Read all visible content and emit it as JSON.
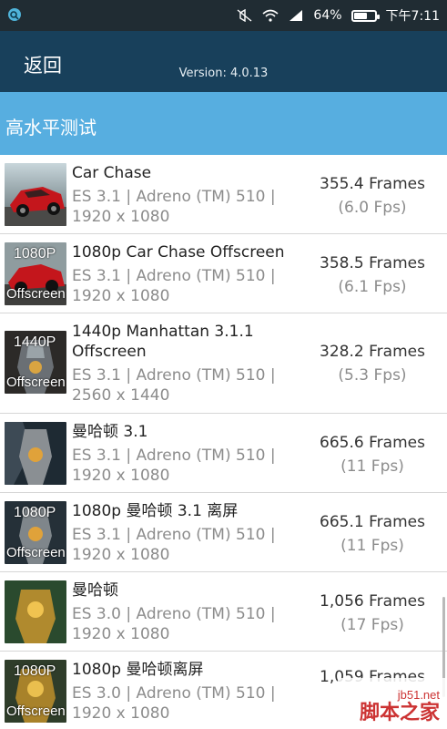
{
  "status_bar": {
    "app_icon": "search-icon",
    "icons": [
      "mute-icon",
      "wifi-icon",
      "signal-icon"
    ],
    "battery_percent": "64%",
    "battery_level": 0.64,
    "time": "下午7:11"
  },
  "header": {
    "back_label": "返回",
    "version": "Version: 4.0.13"
  },
  "section": {
    "title": "高水平测试"
  },
  "tests": [
    {
      "title": "Car Chase",
      "meta1": "ES 3.1 | Adreno (TM) 510 |",
      "meta2": "1920 x 1080",
      "frames": "355.4 Frames",
      "fps": "(6.0 Fps)",
      "thumb_top": "",
      "thumb_bottom": ""
    },
    {
      "title": "1080p Car Chase Offscreen",
      "meta1": "ES 3.1 | Adreno (TM) 510 |",
      "meta2": "1920 x 1080",
      "frames": "358.5 Frames",
      "fps": "(6.1 Fps)",
      "thumb_top": "1080P",
      "thumb_bottom": "Offscreen"
    },
    {
      "title": "1440p Manhattan 3.1.1",
      "title2": "Offscreen",
      "meta1": "ES 3.1 | Adreno (TM) 510 |",
      "meta2": "2560 x 1440",
      "frames": "328.2 Frames",
      "fps": "(5.3 Fps)",
      "thumb_top": "1440P",
      "thumb_bottom": "Offscreen"
    },
    {
      "title": "曼哈顿 3.1",
      "meta1": "ES 3.1 | Adreno (TM) 510 |",
      "meta2": "1920 x 1080",
      "frames": "665.6 Frames",
      "fps": "(11 Fps)",
      "thumb_top": "",
      "thumb_bottom": ""
    },
    {
      "title": "1080p 曼哈顿 3.1 离屏",
      "meta1": "ES 3.1 | Adreno (TM) 510 |",
      "meta2": "1920 x 1080",
      "frames": "665.1 Frames",
      "fps": "(11 Fps)",
      "thumb_top": "1080P",
      "thumb_bottom": "Offscreen"
    },
    {
      "title": "曼哈顿",
      "meta1": "ES 3.0 | Adreno (TM) 510 |",
      "meta2": "1920 x 1080",
      "frames": "1,056 Frames",
      "fps": "(17 Fps)",
      "thumb_top": "",
      "thumb_bottom": ""
    },
    {
      "title": "1080p 曼哈顿离屏",
      "meta1": "ES 3.0 | Adreno (TM) 510 |",
      "meta2": "1920 x 1080",
      "frames": "1,059 Frames",
      "fps": "",
      "thumb_top": "1080P",
      "thumb_bottom": "Offscreen"
    }
  ],
  "watermark": {
    "site": "jb51.net",
    "name": "脚本之家"
  },
  "colors": {
    "status_bar": "#202c33",
    "header": "#18405b",
    "section": "#57aee0"
  }
}
